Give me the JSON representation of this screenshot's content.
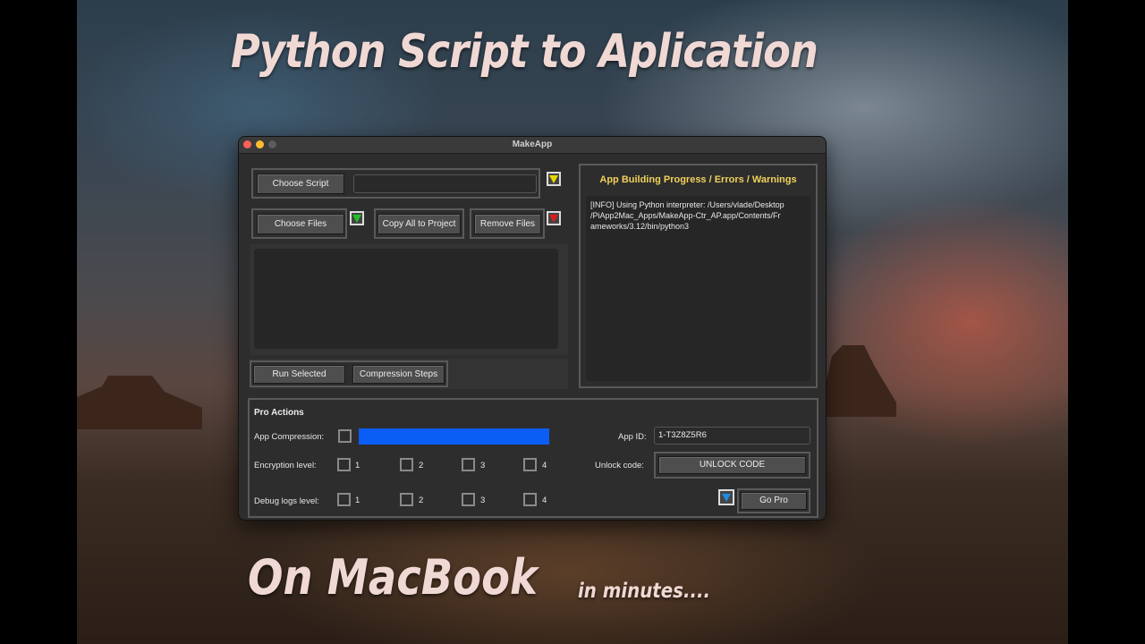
{
  "overlay": {
    "title_top": "Python Script to Aplication",
    "title_bottom": "On MacBook",
    "title_small": "in minutes...."
  },
  "window": {
    "title": "MakeApp"
  },
  "toolbar": {
    "choose_script_label": "Choose Script",
    "script_path_value": "",
    "choose_files_label": "Choose Files",
    "copy_all_label": "Copy All to Project",
    "remove_files_label": "Remove Files",
    "run_selected_label": "Run Selected",
    "compression_steps_label": "Compression Steps"
  },
  "log_panel": {
    "title": "App Building Progress / Errors / Warnings",
    "lines": [
      "[INFO] Using Python interpreter: /Users/vlade/Desktop",
      "/PiApp2Mac_Apps/MakeApp-Ctr_AP.app/Contents/Fr",
      "ameworks/3.12/bin/python3"
    ]
  },
  "pro_actions": {
    "title": "Pro Actions",
    "app_compression_label": "App Compression:",
    "encryption_label": "Encryption level:",
    "debug_label": "Debug logs level:",
    "levels": [
      "1",
      "2",
      "3",
      "4"
    ],
    "app_id_label": "App ID:",
    "app_id_value": "1-T3Z8Z5R6",
    "unlock_label": "Unlock code:",
    "unlock_button": "UNLOCK CODE",
    "go_pro_button": "Go Pro"
  },
  "colors": {
    "progress_bar": "#0a5ef5",
    "log_title": "#f2d15c"
  },
  "icons": {
    "script_dropdown": "yellow-triangle-icon",
    "add_files": "green-triangle-icon",
    "remove_files": "red-triangle-icon",
    "go_pro": "blue-triangle-icon"
  }
}
